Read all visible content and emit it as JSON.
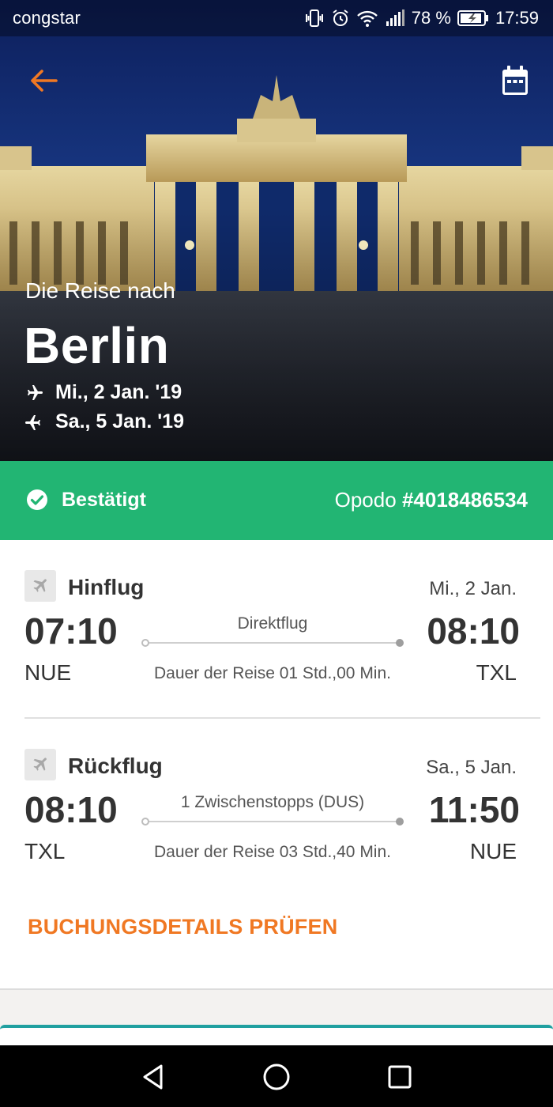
{
  "status_bar": {
    "carrier": "congstar",
    "battery": "78 %",
    "time": "17:59"
  },
  "header": {
    "back_icon": "arrow-left-icon",
    "calendar_icon": "calendar-icon"
  },
  "trip": {
    "subtitle": "Die Reise nach",
    "city": "Berlin",
    "outbound_date": "Mi., 2 Jan. '19",
    "return_date": "Sa., 5 Jan. '19"
  },
  "booking": {
    "status": "Bestätigt",
    "provider": "Opodo",
    "number": "#4018486534"
  },
  "outbound": {
    "title": "Hinflug",
    "date": "Mi., 2 Jan.",
    "dep_time": "07:10",
    "arr_time": "08:10",
    "dep_airport": "NUE",
    "arr_airport": "TXL",
    "stops": "Direktflug",
    "duration": "Dauer der Reise 01 Std.,00 Min."
  },
  "return": {
    "title": "Rückflug",
    "date": "Sa., 5 Jan.",
    "dep_time": "08:10",
    "arr_time": "11:50",
    "dep_airport": "TXL",
    "arr_airport": "NUE",
    "stops": "1 Zwischenstopps (DUS)",
    "duration": "Dauer der Reise 03 Std.,40 Min."
  },
  "actions": {
    "check_details": "BUCHUNGSDETAILS PRÜFEN"
  },
  "colors": {
    "accent": "#f07823",
    "confirmed": "#22b573"
  }
}
